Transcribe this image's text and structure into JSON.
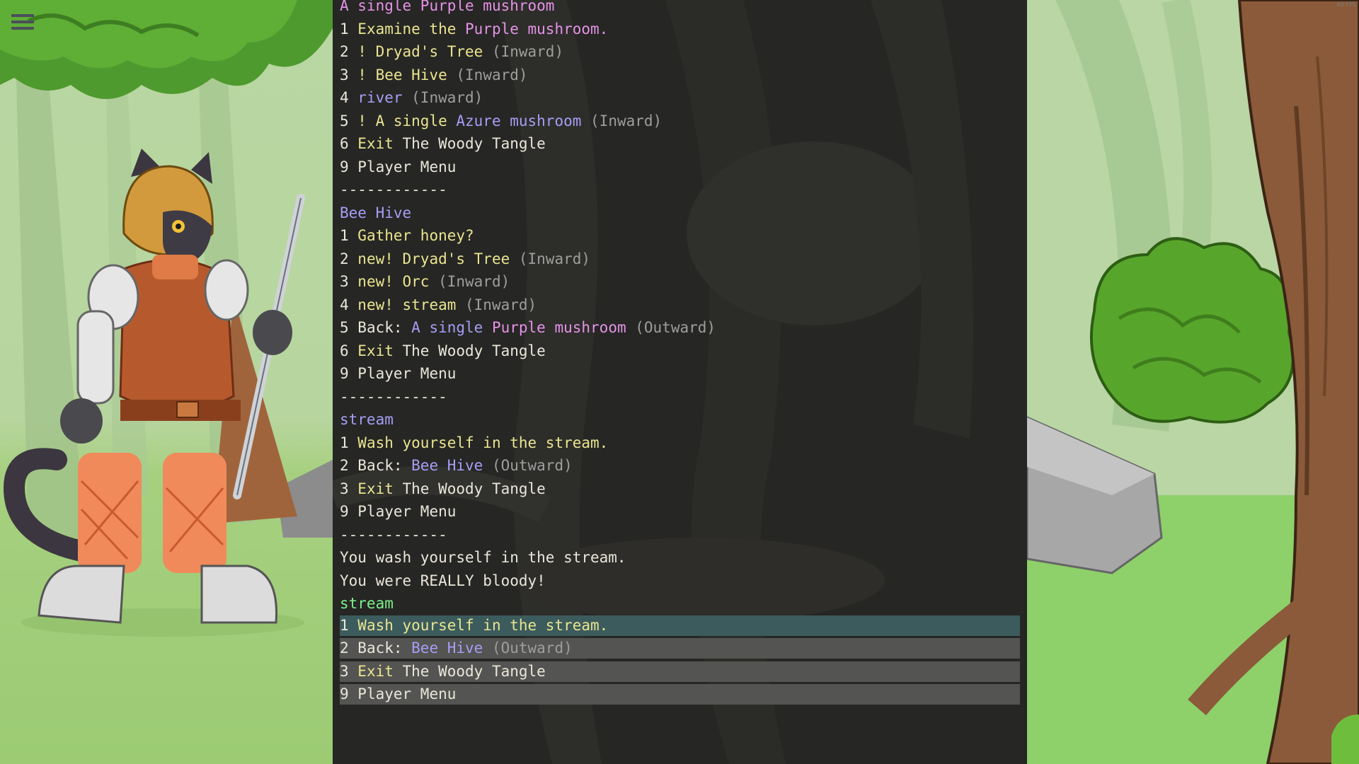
{
  "hud": {
    "fps": "60 FPS"
  },
  "log": [
    {
      "segments": [
        {
          "t": "A single ",
          "c": "p"
        },
        {
          "t": "Purple mushroom",
          "c": "p"
        }
      ]
    },
    {
      "segments": [
        {
          "t": "1 ",
          "c": "w"
        },
        {
          "t": "Examine the ",
          "c": "y"
        },
        {
          "t": "Purple mushroom.",
          "c": "p"
        }
      ]
    },
    {
      "segments": [
        {
          "t": "2 ",
          "c": "w"
        },
        {
          "t": "! Dryad's Tree ",
          "c": "y"
        },
        {
          "t": "(Inward)",
          "c": "g"
        }
      ]
    },
    {
      "segments": [
        {
          "t": "3 ",
          "c": "w"
        },
        {
          "t": "! Bee Hive ",
          "c": "y"
        },
        {
          "t": "(Inward)",
          "c": "g"
        }
      ]
    },
    {
      "segments": [
        {
          "t": "4 ",
          "c": "w"
        },
        {
          "t": "river ",
          "c": "b"
        },
        {
          "t": "(Inward)",
          "c": "g"
        }
      ]
    },
    {
      "segments": [
        {
          "t": "5 ",
          "c": "w"
        },
        {
          "t": "! A single ",
          "c": "y"
        },
        {
          "t": "Azure mushroom ",
          "c": "b"
        },
        {
          "t": "(Inward)",
          "c": "g"
        }
      ]
    },
    {
      "segments": [
        {
          "t": "6 ",
          "c": "w"
        },
        {
          "t": "Exit ",
          "c": "y"
        },
        {
          "t": "The Woody Tangle",
          "c": "w"
        }
      ]
    },
    {
      "segments": [
        {
          "t": "9 ",
          "c": "w"
        },
        {
          "t": "Player Menu",
          "c": "w"
        }
      ]
    },
    {
      "segments": [
        {
          "t": "------------",
          "c": "w"
        }
      ]
    },
    {
      "segments": [
        {
          "t": "Bee Hive",
          "c": "b"
        }
      ]
    },
    {
      "segments": [
        {
          "t": "1 ",
          "c": "w"
        },
        {
          "t": "Gather honey?",
          "c": "y"
        }
      ]
    },
    {
      "segments": [
        {
          "t": "2 ",
          "c": "w"
        },
        {
          "t": "new! Dryad's Tree ",
          "c": "y"
        },
        {
          "t": "(Inward)",
          "c": "g"
        }
      ]
    },
    {
      "segments": [
        {
          "t": "3 ",
          "c": "w"
        },
        {
          "t": "new! Orc ",
          "c": "y"
        },
        {
          "t": "(Inward)",
          "c": "g"
        }
      ]
    },
    {
      "segments": [
        {
          "t": "4 ",
          "c": "w"
        },
        {
          "t": "new! stream ",
          "c": "y"
        },
        {
          "t": "(Inward)",
          "c": "g"
        }
      ]
    },
    {
      "segments": [
        {
          "t": "5 ",
          "c": "w"
        },
        {
          "t": "Back: ",
          "c": "w"
        },
        {
          "t": "A single ",
          "c": "b"
        },
        {
          "t": "Purple mushroom ",
          "c": "p"
        },
        {
          "t": "(Outward)",
          "c": "g"
        }
      ]
    },
    {
      "segments": [
        {
          "t": "6 ",
          "c": "w"
        },
        {
          "t": "Exit ",
          "c": "y"
        },
        {
          "t": "The Woody Tangle",
          "c": "w"
        }
      ]
    },
    {
      "segments": [
        {
          "t": "9 ",
          "c": "w"
        },
        {
          "t": "Player Menu",
          "c": "w"
        }
      ]
    },
    {
      "segments": [
        {
          "t": "------------",
          "c": "w"
        }
      ]
    },
    {
      "segments": [
        {
          "t": "stream",
          "c": "b"
        }
      ]
    },
    {
      "segments": [
        {
          "t": "1 ",
          "c": "w"
        },
        {
          "t": "Wash yourself in the stream.",
          "c": "y"
        }
      ]
    },
    {
      "segments": [
        {
          "t": "2 ",
          "c": "w"
        },
        {
          "t": "Back: ",
          "c": "w"
        },
        {
          "t": "Bee Hive ",
          "c": "b"
        },
        {
          "t": "(Outward)",
          "c": "g"
        }
      ]
    },
    {
      "segments": [
        {
          "t": "3 ",
          "c": "w"
        },
        {
          "t": "Exit ",
          "c": "y"
        },
        {
          "t": "The Woody Tangle",
          "c": "w"
        }
      ]
    },
    {
      "segments": [
        {
          "t": "9 ",
          "c": "w"
        },
        {
          "t": "Player Menu",
          "c": "w"
        }
      ]
    },
    {
      "segments": [
        {
          "t": "------------",
          "c": "w"
        }
      ]
    },
    {
      "segments": [
        {
          "t": "You wash yourself in the stream.",
          "c": "w"
        }
      ]
    },
    {
      "segments": [
        {
          "t": "You were REALLY bloody!",
          "c": "w"
        }
      ]
    },
    {
      "segments": [
        {
          "t": "stream",
          "c": "gr"
        }
      ]
    }
  ],
  "choices": [
    {
      "active": true,
      "segments": [
        {
          "t": "1 ",
          "c": "w"
        },
        {
          "t": "Wash yourself in the stream.",
          "c": "y"
        }
      ]
    },
    {
      "active": false,
      "segments": [
        {
          "t": "2 ",
          "c": "w"
        },
        {
          "t": "Back: ",
          "c": "w"
        },
        {
          "t": "Bee Hive ",
          "c": "b"
        },
        {
          "t": "(Outward)",
          "c": "g"
        }
      ]
    },
    {
      "active": false,
      "segments": [
        {
          "t": "3 ",
          "c": "w"
        },
        {
          "t": "Exit ",
          "c": "y"
        },
        {
          "t": "The Woody Tangle",
          "c": "w"
        }
      ]
    },
    {
      "active": false,
      "segments": [
        {
          "t": "9 ",
          "c": "w"
        },
        {
          "t": "Player Menu",
          "c": "w"
        }
      ]
    }
  ],
  "colors": {
    "panel_bg": "#262624",
    "text_default": "#eae6da",
    "text_action": "#e9e591",
    "text_location": "#a59ef4",
    "text_purple": "#e493e6",
    "text_direction": "#9e9e9e",
    "text_current_location": "#7cf08b",
    "choice_bg": "#545452",
    "choice_active_bg": "#3c5b5c"
  },
  "icons": {
    "menu": "hamburger-menu-icon"
  }
}
